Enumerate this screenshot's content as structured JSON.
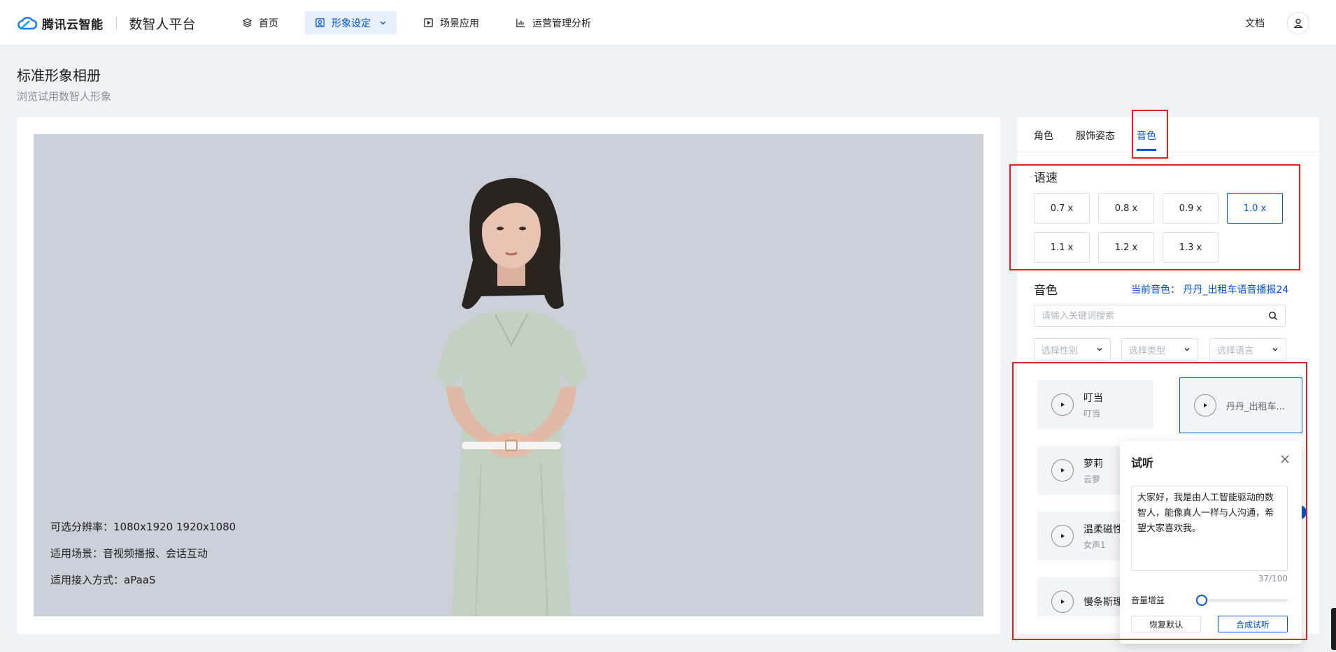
{
  "brand": {
    "name": "腾讯云智能",
    "platform": "数智人平台",
    "logo_icon": "cloud-logo-icon"
  },
  "nav": {
    "items": [
      {
        "label": "首页",
        "icon": "layers-icon"
      },
      {
        "label": "形象设定",
        "icon": "portrait-icon",
        "active": true
      },
      {
        "label": "场景应用",
        "icon": "play-square-icon"
      },
      {
        "label": "运营管理分析",
        "icon": "bar-chart-icon"
      }
    ],
    "docs": "文档",
    "user_icon": "user-icon"
  },
  "page": {
    "title": "标准形象相册",
    "subtitle": "浏览试用数智人形象"
  },
  "preview": {
    "info": [
      "可选分辨率：1080x1920 1920x1080",
      "适用场景：音视频播报、会话互动",
      "适用接入方式：aPaaS"
    ]
  },
  "panel": {
    "tabs": [
      "角色",
      "服饰姿态",
      "音色"
    ],
    "active_tab": "音色",
    "speed": {
      "label": "语速",
      "options": [
        "0.7 x",
        "0.8 x",
        "0.9 x",
        "1.0 x",
        "1.1 x",
        "1.2 x",
        "1.3 x"
      ],
      "selected": "1.0 x"
    },
    "voice": {
      "label": "音色",
      "current": "当前音色：  丹丹_出租车语音播报24",
      "search_placeholder": "请输入关键词搜索",
      "filters": [
        "选择性别",
        "选择类型",
        "选择语言"
      ],
      "list": [
        {
          "name": "叮当",
          "sub": "叮当"
        },
        {
          "name": "丹丹_出租车...",
          "sub": "",
          "selected": true
        },
        {
          "name": "萝莉",
          "sub": "云萝"
        },
        {
          "name": "温柔磁性",
          "sub": "女声1"
        },
        {
          "name": "慢条斯理",
          "sub": ""
        }
      ]
    }
  },
  "popover": {
    "title": "试听",
    "text": "大家好，我是由人工智能驱动的数智人，能像真人一样与人沟通，希望大家喜欢我。",
    "count": "37/100",
    "volume_label": "音量增益",
    "volume_level": 0,
    "reset_label": "恢复默认",
    "submit_label": "合成试听"
  },
  "colors": {
    "accent": "#0052d9",
    "annotation": "#e52020",
    "stage_bg": "#ccd0d8"
  }
}
